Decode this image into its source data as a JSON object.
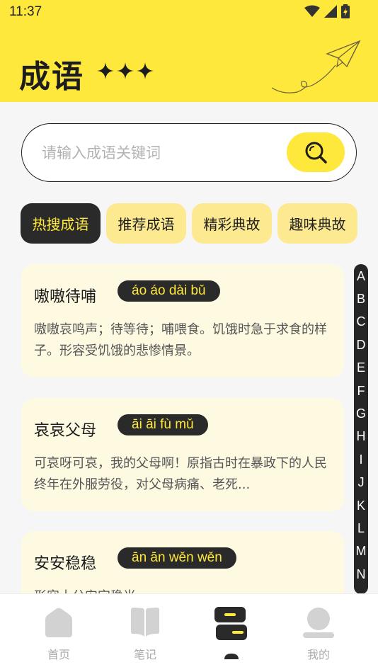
{
  "status": {
    "time": "11:37"
  },
  "header": {
    "title": "成语"
  },
  "search": {
    "placeholder": "请输入成语关键词"
  },
  "tabs": [
    {
      "label": "热搜成语",
      "active": true
    },
    {
      "label": "推荐成语",
      "active": false
    },
    {
      "label": "精彩典故",
      "active": false
    },
    {
      "label": "趣味典故",
      "active": false
    }
  ],
  "cards": [
    {
      "title": "嗷嗷待哺",
      "pinyin": "áo áo dài bǔ",
      "desc": "嗷嗷哀鸣声；待等待；哺喂食。饥饿时急于求食的样子。形容受饥饿的悲惨情景。"
    },
    {
      "title": "哀哀父母",
      "pinyin": "āi āi fù mǔ",
      "desc": "可哀呀可哀，我的父母啊！原指古时在暴政下的人民终年在外服劳役，对父母病痛、老死..."
    },
    {
      "title": "安安稳稳",
      "pinyin": "ān ān wěn wěn",
      "desc": "形容十分安定稳当。"
    }
  ],
  "alphabet": [
    "A",
    "B",
    "C",
    "D",
    "E",
    "F",
    "G",
    "H",
    "I",
    "J",
    "K",
    "L",
    "M",
    "N"
  ],
  "nav": [
    {
      "label": "首页",
      "icon": "home-icon",
      "active": false
    },
    {
      "label": "笔记",
      "icon": "book-icon",
      "active": false
    },
    {
      "label": "",
      "icon": "list-icon",
      "active": true
    },
    {
      "label": "我的",
      "icon": "profile-icon",
      "active": false
    }
  ],
  "colors": {
    "accent": "#ffe83c",
    "dark": "#2a2a2a",
    "card": "#fefae2",
    "tab": "#fde98f"
  }
}
